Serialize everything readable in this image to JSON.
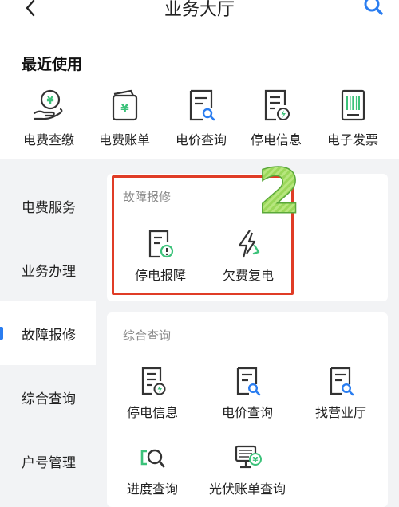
{
  "header": {
    "title": "业务大厅",
    "back_icon": "chevron-left-icon",
    "search_icon": "search-icon"
  },
  "recent": {
    "title": "最近使用",
    "items": [
      {
        "label": "电费查缴",
        "icon": "hand-coin-icon"
      },
      {
        "label": "电费账单",
        "icon": "wallet-yuan-icon"
      },
      {
        "label": "电价查询",
        "icon": "doc-search-icon"
      },
      {
        "label": "停电信息",
        "icon": "doc-bolt-icon"
      },
      {
        "label": "电子发票",
        "icon": "barcode-doc-icon"
      }
    ]
  },
  "sidebar": {
    "items": [
      {
        "label": "电费服务"
      },
      {
        "label": "业务办理"
      },
      {
        "label": "故障报修"
      },
      {
        "label": "综合查询"
      },
      {
        "label": "户号管理"
      }
    ],
    "active_index": 2
  },
  "fault": {
    "title": "故障报修",
    "items": [
      {
        "label": "停电报障",
        "icon": "doc-alert-icon"
      },
      {
        "label": "欠费复电",
        "icon": "bolt-arrow-icon"
      }
    ],
    "badge_number": "2"
  },
  "query": {
    "title": "综合查询",
    "items": [
      {
        "label": "停电信息",
        "icon": "doc-bolt-icon"
      },
      {
        "label": "电价查询",
        "icon": "doc-search-icon"
      },
      {
        "label": "找营业厅",
        "icon": "doc-search-icon"
      },
      {
        "label": "进度查询",
        "icon": "progress-search-icon"
      },
      {
        "label": "光伏账单查询",
        "icon": "monitor-yuan-icon"
      }
    ]
  },
  "colors": {
    "accent_green": "#3cc27a",
    "accent_blue": "#2a7df0",
    "highlight_red": "#e03c26",
    "badge_green": "#8fd14f"
  }
}
